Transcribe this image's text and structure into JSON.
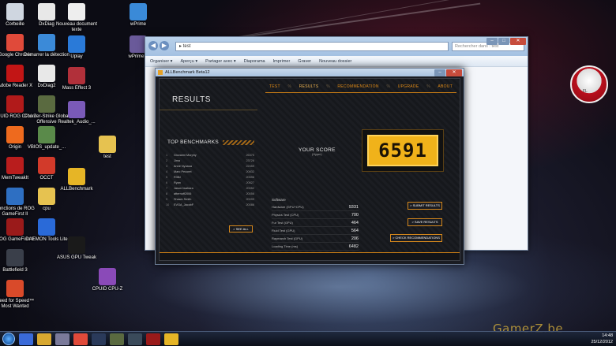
{
  "desktop": {
    "icons": [
      {
        "label": "Corbeille",
        "color": "#cfd6e0"
      },
      {
        "label": "Google Chrome",
        "color": "#e04a3a"
      },
      {
        "label": "Adobe Reader X",
        "color": "#c21515"
      },
      {
        "label": "CPUID ROG CPU-Z",
        "color": "#b11a1a"
      },
      {
        "label": "Origin",
        "color": "#ee6a1e"
      },
      {
        "label": "MemTweakIt",
        "color": "#b91d1d"
      },
      {
        "label": "Fonctions de ROG GameFirst II",
        "color": "#2e6fc2"
      },
      {
        "label": "ROG GameFirst II",
        "color": "#9a1a1a"
      },
      {
        "label": "Battlefield 3",
        "color": "#3a3f4a"
      },
      {
        "label": "Need for Speed™ Most Wanted",
        "color": "#d94a2a"
      },
      {
        "label": "DxDiag",
        "color": "#e8e8e8"
      },
      {
        "label": "Démarrer la détection",
        "color": "#3b8ad8"
      },
      {
        "label": "DxDiag2",
        "color": "#e8e8e8"
      },
      {
        "label": "Counter-Strike Global Offensive",
        "color": "#5a6a40"
      },
      {
        "label": "VBIOS_update_...",
        "color": "#5a8a4a"
      },
      {
        "label": "OCCT",
        "color": "#d23a2a"
      },
      {
        "label": "cpu",
        "color": "#e6c250"
      },
      {
        "label": "DAEMON Tools Lite",
        "color": "#2a6ad8"
      },
      {
        "label": "Nouveau document texte",
        "color": "#eeeeee"
      },
      {
        "label": "Uplay",
        "color": "#2a7ad8"
      },
      {
        "label": "Mass Effect 3",
        "color": "#b1303a"
      },
      {
        "label": "Realtek_Audio_...",
        "color": "#7a5ab8"
      },
      {
        "label": "ALLBenchmark",
        "color": "#e6b526"
      },
      {
        "label": "ASUS GPU Tweak",
        "color": "#1a1a1a"
      },
      {
        "label": "wPrime",
        "color": "#3a8ad8"
      },
      {
        "label": "wPrime...",
        "color": "#6a5a9a"
      },
      {
        "label": "test",
        "color": "#e6c250"
      },
      {
        "label": "CPUID CPU-Z",
        "color": "#8a4ab8"
      }
    ]
  },
  "explorer": {
    "address": "test",
    "search_placeholder": "Rechercher dans : test",
    "toolbar": [
      "Organiser ▾",
      "Aperçu ▾",
      "Partager avec ▾",
      "Diaporama",
      "Imprimer",
      "Graver",
      "Nouveau dossier"
    ]
  },
  "bench": {
    "window_title": "ALLBenchmark Beta12",
    "results_title": "RESULTS",
    "nav": [
      {
        "label": "TEST",
        "active": false
      },
      {
        "label": "RESULTS",
        "active": true
      },
      {
        "label": "RECOMMENDATION",
        "active": false
      },
      {
        "label": "UPGRADE",
        "active": false
      },
      {
        "label": "ABOUT",
        "active": false
      }
    ],
    "top_benchmarks_title": "TOP BENCHMARKS",
    "top_benchmarks": [
      {
        "rank": "1",
        "name": "Giovanni Murphy",
        "score": "26375"
      },
      {
        "rank": "2",
        "name": "Jima",
        "score": "23726"
      },
      {
        "rank": "3",
        "name": "Anne Nyoaua",
        "score": "22459"
      },
      {
        "rank": "4",
        "name": "Marc Pecoret",
        "score": "20832"
      },
      {
        "rank": "5",
        "name": "R3fkl",
        "score": "20596"
      },
      {
        "rank": "6",
        "name": "Ryan",
        "score": "20627"
      },
      {
        "rank": "7",
        "name": "Jason Iwahara",
        "score": "20052"
      },
      {
        "rank": "8",
        "name": "afternoff2006",
        "score": "20056"
      },
      {
        "rank": "9",
        "name": "Shawn Smith",
        "score": "20099"
      },
      {
        "rank": "10",
        "name": "EVGA_JacobF",
        "score": "20086"
      }
    ],
    "see_all": "> SEE ALL",
    "your_score_label": "YOUR SCORE",
    "your_score_sub": "(Hyper)",
    "score": "6591",
    "software_title": "Software",
    "metrics": [
      {
        "name": "Hardware (GPU+CPU)",
        "value": "9331"
      },
      {
        "name": "Physics Test (CPU)",
        "value": "700"
      },
      {
        "name": "Fur Test (GPU)",
        "value": "464"
      },
      {
        "name": "Fluid Test (GPU)",
        "value": "564"
      },
      {
        "name": "Raymarch Test (GPU)",
        "value": "206"
      },
      {
        "name": "Loading Time (ms)",
        "value": "6482"
      }
    ],
    "submit_results": "> SUBMIT RESULTS",
    "save_results": "> SAVE RESULTS",
    "check_recommendations": "> CHECK RECOMMENDATIONS"
  },
  "widget": {
    "label": "FL"
  },
  "watermark": "GamerZ.be",
  "taskbar": {
    "apps": [
      {
        "color": "#3a6ad8"
      },
      {
        "color": "#d8a830"
      },
      {
        "color": "#7a7a9a"
      },
      {
        "color": "#e04a3a"
      },
      {
        "color": "#2a3a5a"
      },
      {
        "color": "#5a6a40"
      },
      {
        "color": "#3a4a5a"
      },
      {
        "color": "#9a1a1a"
      },
      {
        "color": "#e6b526"
      }
    ],
    "time": "14:48",
    "date": "25/12/2012"
  }
}
